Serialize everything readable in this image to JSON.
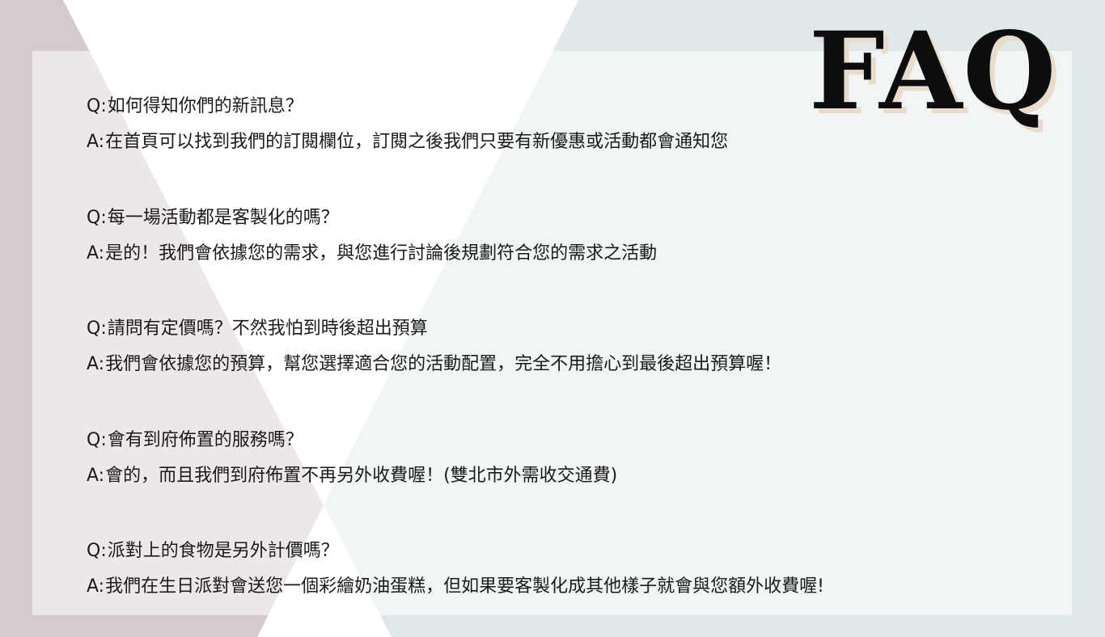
{
  "title": "FAQ",
  "faq": [
    {
      "q_prefix": "Q:",
      "question": "如何得知你們的新訊息？",
      "a_prefix": "A:",
      "answer": "在首頁可以找到我們的訂閱欄位，訂閱之後我們只要有新優惠或活動都會通知您"
    },
    {
      "q_prefix": "Q:",
      "question": "每一場活動都是客製化的嗎？",
      "a_prefix": "A:",
      "answer": "是的！我們會依據您的需求，與您進行討論後規劃符合您的需求之活動"
    },
    {
      "q_prefix": "Q:",
      "question": "請問有定價嗎？不然我怕到時後超出預算",
      "a_prefix": "A:",
      "answer": "我們會依據您的預算，幫您選擇適合您的活動配置，完全不用擔心到最後超出預算喔！"
    },
    {
      "q_prefix": "Q:",
      "question": "會有到府佈置的服務嗎？",
      "a_prefix": "A:",
      "answer": "會的，而且我們到府佈置不再另外收費喔！(雙北市外需收交通費)"
    },
    {
      "q_prefix": "Q:",
      "question": "派對上的食物是另外計價嗎？",
      "a_prefix": "A:",
      "answer": "我們在生日派對會送您一個彩繪奶油蛋糕，但如果要客製化成其他樣子就會與您額外收費喔!"
    }
  ]
}
